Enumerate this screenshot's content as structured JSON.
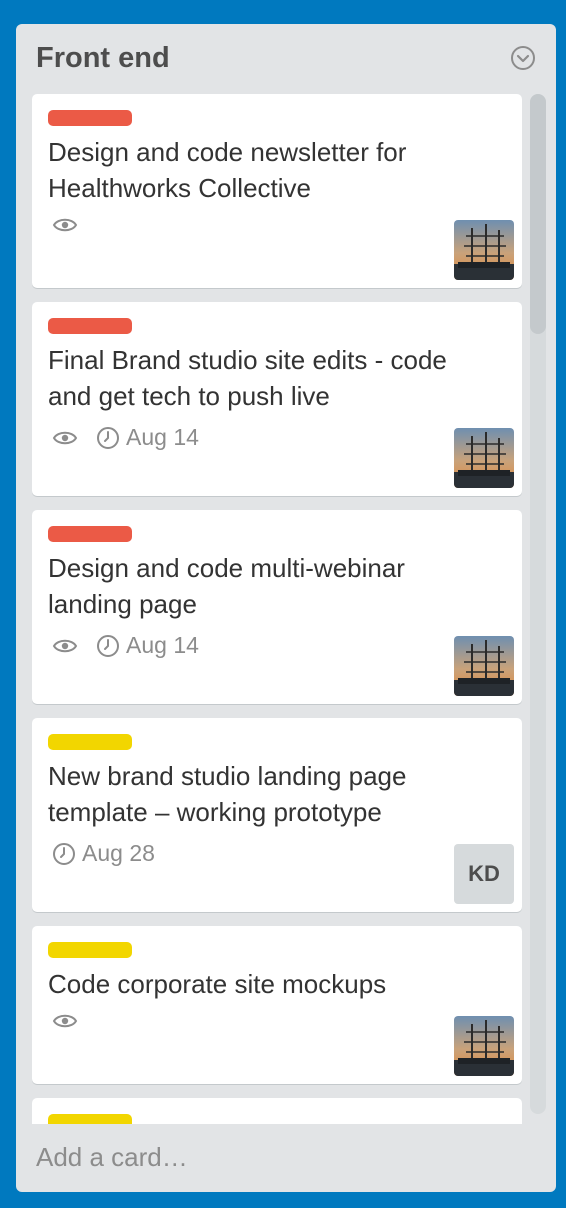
{
  "list": {
    "title": "Front end",
    "menu_icon": "chevron-down-circle-icon",
    "add_card_label": "Add a card…"
  },
  "colors": {
    "board_background": "#0079bf",
    "list_background": "#e2e4e6",
    "label_red": "#eb5a46",
    "label_yellow": "#f2d600"
  },
  "cards": [
    {
      "label_color": "red",
      "title_lines": [
        "Design and code newsletter for",
        "Healthworks Collective"
      ],
      "watch": true,
      "due": "",
      "member": "photo"
    },
    {
      "label_color": "red",
      "title_lines": [
        "Final Brand studio site edits - code",
        "and get tech to push live"
      ],
      "watch": true,
      "due": "Aug 14",
      "member": "photo"
    },
    {
      "label_color": "red",
      "title_lines": [
        "Design and code multi-webinar",
        "landing page"
      ],
      "watch": true,
      "due": "Aug 14",
      "member": "photo"
    },
    {
      "label_color": "yellow",
      "title_lines": [
        "New brand studio landing page",
        "template – working prototype"
      ],
      "watch": false,
      "due": "Aug 28",
      "member": "KD"
    },
    {
      "label_color": "yellow",
      "title_lines": [
        "Code corporate site mockups"
      ],
      "watch": true,
      "due": "",
      "member": "photo"
    },
    {
      "label_color": "yellow",
      "title_lines": [],
      "watch": false,
      "due": "",
      "member": ""
    }
  ]
}
